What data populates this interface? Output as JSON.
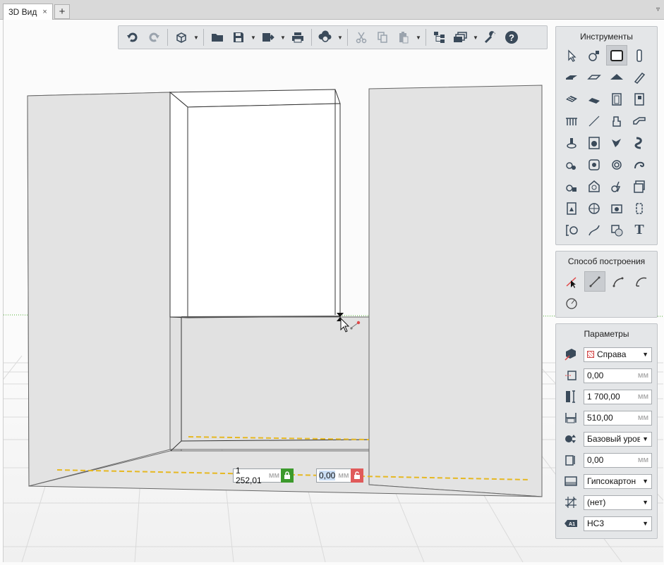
{
  "tabs": [
    {
      "label": "3D Вид",
      "close": "×"
    }
  ],
  "tab_add_label": "+",
  "tab_menu_label": "▿",
  "toolbar": {
    "icons": [
      "undo-icon",
      "redo-icon",
      "view-cube-icon",
      "open-folder-icon",
      "save-icon",
      "export-icon",
      "print-icon",
      "sync-cloud-icon",
      "cut-icon",
      "copy-icon",
      "paste-icon",
      "structure-icon",
      "layers-icon",
      "wrench-icon",
      "help-icon"
    ]
  },
  "tools_panel": {
    "title": "Инструменты",
    "active_tool": "wall-tool",
    "items": [
      "select-tool",
      "annotation-tool",
      "wall-tool",
      "column-tool",
      "slab-tool",
      "floor-tool",
      "roof-tool",
      "beam-tool",
      "ramp-tool",
      "stair-tool",
      "door-tool",
      "window-tool",
      "railing-tool",
      "line-tool",
      "furniture-tool",
      "duct-tool",
      "plumbing-tool",
      "washer-tool",
      "fitting-tool",
      "pipe-tool",
      "pump-tool",
      "boiler-tool",
      "sensor-tool",
      "cable-tool",
      "radiator-tool",
      "lamp-tool",
      "electric-tool",
      "socket-tool",
      "panel-tool",
      "sphere-tool",
      "camera-tool",
      "door-frame-tool",
      "dimension-tool",
      "curve-tool",
      "hatch-tool",
      "text-tool"
    ],
    "text_tool_glyph": "T"
  },
  "build_panel": {
    "title": "Способ построения",
    "active_mode": "line-mode",
    "items": [
      "pick-mode",
      "line-mode",
      "arc-mode",
      "tangent-arc-mode",
      "circle-mode"
    ]
  },
  "params_panel": {
    "title": "Параметры",
    "rows": [
      {
        "icon": "location-icon",
        "type": "select",
        "value": "Справа",
        "swatch": true
      },
      {
        "icon": "offset-icon",
        "type": "number",
        "value": "0,00",
        "unit": "мм"
      },
      {
        "icon": "height-icon",
        "type": "number",
        "value": "1 700,00",
        "unit": "мм"
      },
      {
        "icon": "thickness-icon",
        "type": "number",
        "value": "510,00",
        "unit": "мм"
      },
      {
        "icon": "level-icon",
        "type": "select",
        "value": "Базовый урове"
      },
      {
        "icon": "elevation-icon",
        "type": "number",
        "value": "0,00",
        "unit": "мм"
      },
      {
        "icon": "material-icon",
        "type": "select",
        "value": "Гипсокартон"
      },
      {
        "icon": "hatch-icon",
        "type": "select",
        "value": "(нет)"
      },
      {
        "icon": "label-icon",
        "type": "select",
        "value": "НС3"
      }
    ]
  },
  "dimensions": {
    "length": {
      "value": "1 252,01",
      "unit": "мм",
      "locked": true
    },
    "angle": {
      "value": "0,00",
      "unit": "мм",
      "locked": false
    }
  },
  "colors": {
    "lock_locked": "#3c9a2c",
    "lock_unlocked": "#e05a5a",
    "guide_line": "#e6b822",
    "axis_line": "#4caf2e",
    "wall_face": "#e3e3e3"
  }
}
